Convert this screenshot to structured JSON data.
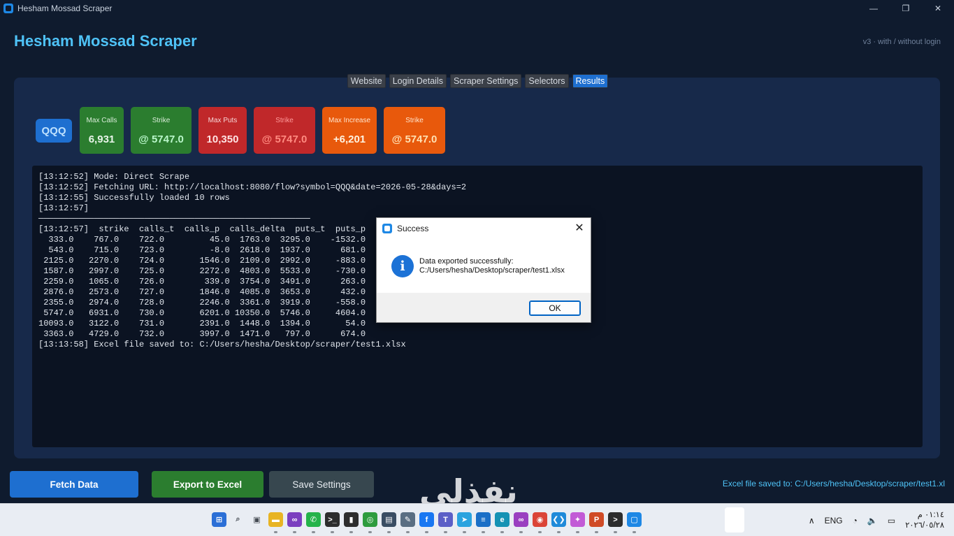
{
  "window": {
    "title": "Hesham Mossad Scraper",
    "minimize": "—",
    "maximize": "❐",
    "close": "✕"
  },
  "header": {
    "title": "Hesham Mossad Scraper",
    "version": "v3 · with / without login"
  },
  "tabs": [
    {
      "label": "Website"
    },
    {
      "label": "Login Details"
    },
    {
      "label": "Scraper Settings"
    },
    {
      "label": "Selectors"
    },
    {
      "label": "Results"
    }
  ],
  "stats": {
    "symbol": "QQQ",
    "cards": [
      {
        "label": "Max Calls",
        "value": "6,931"
      },
      {
        "label": "Strike",
        "value": "@ 5747.0"
      },
      {
        "label": "Max Puts",
        "value": "10,350"
      },
      {
        "label": "Strike",
        "value": "@ 5747.0"
      },
      {
        "label": "Max Increase",
        "value": "+6,201"
      },
      {
        "label": "Strike",
        "value": "@ 5747.0"
      }
    ]
  },
  "console": {
    "text": "[13:12:52] Mode: Direct Scrape\n[13:12:52] Fetching URL: http://localhost:8080/flow?symbol=QQQ&date=2026-05-28&days=2\n[13:12:55] Successfully loaded 10 rows\n[13:12:57]\n──────────────────────────────────────────────────────\n[13:12:57]  strike  calls_t  calls_p  calls_delta  puts_t  puts_p  pu\n  333.0    767.0    722.0         45.0  1763.0  3295.0    -1532.0\n  543.0    715.0    723.0         -8.0  2618.0  1937.0      681.0\n 2125.0   2270.0    724.0       1546.0  2109.0  2992.0     -883.0\n 1587.0   2997.0    725.0       2272.0  4803.0  5533.0     -730.0\n 2259.0   1065.0    726.0        339.0  3754.0  3491.0      263.0\n 2876.0   2573.0    727.0       1846.0  4085.0  3653.0      432.0\n 2355.0   2974.0    728.0       2246.0  3361.0  3919.0     -558.0\n 5747.0   6931.0    730.0       6201.0 10350.0  5746.0     4604.0\n10093.0   3122.0    731.0       2391.0  1448.0  1394.0       54.0\n 3363.0   4729.0    732.0       3997.0  1471.0   797.0      674.0\n[13:13:58] Excel file saved to: C:/Users/hesha/Desktop/scraper/test1.xlsx"
  },
  "dialog": {
    "title": "Success",
    "message_line1": "Data exported successfully:",
    "message_line2": "C:/Users/hesha/Desktop/scraper/test1.xlsx",
    "ok_label": "OK",
    "info_glyph": "i",
    "close_glyph": "✕"
  },
  "actions": {
    "fetch_label": "Fetch Data",
    "export_label": "Export to Excel",
    "save_label": "Save Settings"
  },
  "status": {
    "text": "Excel file saved to: C:/Users/hesha/Desktop/scraper/test1.xl"
  },
  "watermark": {
    "text": "نفذلي"
  },
  "taskbar": {
    "apps": [
      {
        "name": "start-icon",
        "color": "#2b6fd6",
        "glyph": "⊞"
      },
      {
        "name": "search-icon",
        "color": "#444a52",
        "glyph": "⌕"
      },
      {
        "name": "task-view-icon",
        "color": "#444a52",
        "glyph": "▣"
      },
      {
        "name": "file-explorer-icon",
        "color": "#e8b423",
        "glyph": "▬"
      },
      {
        "name": "visual-studio-icon",
        "color": "#7b3fbf",
        "glyph": "∞"
      },
      {
        "name": "whatsapp-icon",
        "color": "#25b34a",
        "glyph": "✆"
      },
      {
        "name": "cmd-icon",
        "color": "#2d2d2d",
        "glyph": ">_"
      },
      {
        "name": "piano-icon",
        "color": "#2d2d2d",
        "glyph": "▮"
      },
      {
        "name": "refresh-app-icon",
        "color": "#2e9c3e",
        "glyph": "◎"
      },
      {
        "name": "monitor-icon",
        "color": "#3a4d63",
        "glyph": "▤"
      },
      {
        "name": "paint-icon",
        "color": "#5a6e82",
        "glyph": "✎"
      },
      {
        "name": "facebook-icon",
        "color": "#1877f2",
        "glyph": "f"
      },
      {
        "name": "teams-icon",
        "color": "#5b5fc7",
        "glyph": "T"
      },
      {
        "name": "telegram-icon",
        "color": "#2aa3df",
        "glyph": "➤"
      },
      {
        "name": "notepad-icon",
        "color": "#1a6fc7",
        "glyph": "≡"
      },
      {
        "name": "edge-icon",
        "color": "#1592b4",
        "glyph": "e"
      },
      {
        "name": "vs-preview-icon",
        "color": "#9a3fc0",
        "glyph": "∞"
      },
      {
        "name": "chrome-icon",
        "color": "#db4437",
        "glyph": "◉"
      },
      {
        "name": "vscode-icon",
        "color": "#1f8ad9",
        "glyph": "❮❯"
      },
      {
        "name": "copilot-icon",
        "color": "#c25bd6",
        "glyph": "✦"
      },
      {
        "name": "powerpoint-icon",
        "color": "#d04b26",
        "glyph": "P"
      },
      {
        "name": "terminal-icon",
        "color": "#2d2d2d",
        "glyph": ">"
      },
      {
        "name": "scraper-app-icon",
        "color": "#1e88e5",
        "glyph": "▢"
      }
    ],
    "tray_chevron": "∧",
    "language": "ENG",
    "wifi_glyph": "◔",
    "volume_glyph": "🔈",
    "battery_glyph": "▭",
    "time": "٠١:١٤ م",
    "date": "٢٠٢٦/٠٥/٢٨"
  },
  "colors": {
    "accent": "#4fc3f7",
    "primary_button": "#1e6fd0",
    "success": "#2b7d2f",
    "danger": "#c0282a",
    "warning": "#e8590c"
  }
}
